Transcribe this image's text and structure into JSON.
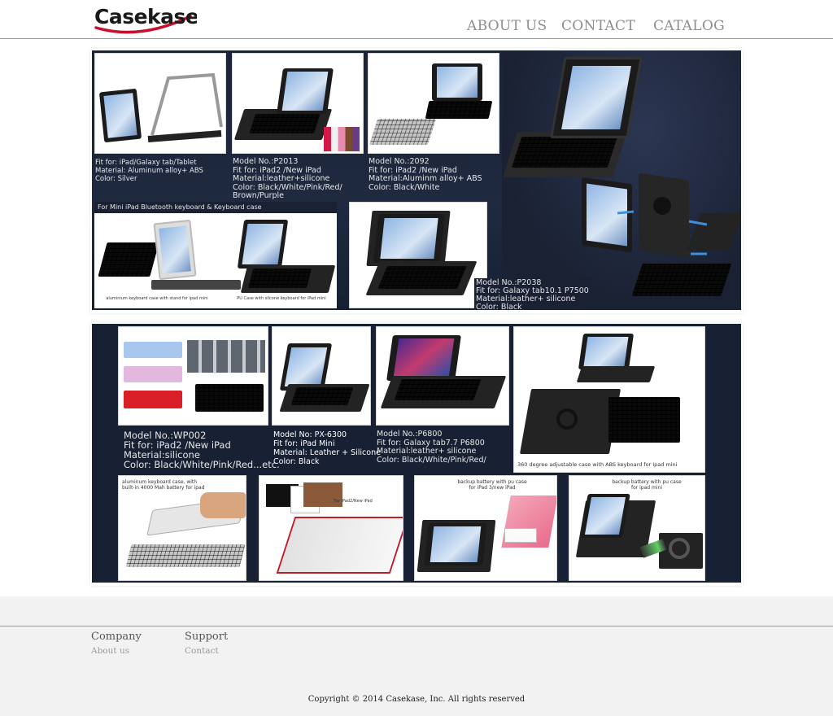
{
  "header": {
    "brand": "Casekase",
    "nav": [
      "ABOUT US",
      "CONTACT",
      "CATALOG"
    ]
  },
  "banner1": {
    "captions": [
      "Fit for: iPad/Galaxy tab/Tablet\nMaterial: Aluminum alloy+ ABS\nColor: Silver",
      "Model No.:P2013\nFit for: iPad2 /New iPad\nMaterial:leather+silicone\nColor: Black/White/Pink/Red/\n        Brown/Purple",
      "Model No.:2092\nFit for: iPad2 /New iPad\nMaterial:Aluminm alloy+ ABS\nColor: Black/White",
      "Model No.:P2038\nFit for: Galaxy tab10.1  P7500\nMaterial:leather+ silicone\nColor: Black"
    ],
    "mini_heading": "For Mini iPad Bluetooth keyboard & Keyboard case",
    "mini_labels": [
      "aluminium keyboard case with stand for ipad mini",
      "PU Case with silcone keyboard for iPad mini"
    ]
  },
  "banner2": {
    "captions": [
      "Model No.:WP002\nFit for: iPad2 /New iPad\nMaterial:silicone\nColor: Black/White/Pink/Red...etc.",
      "Model No: PX-6300\nFit for: iPad Mini\nMaterial: Leather + Silicone\nColor: Black",
      "Model No.:P6800\nFit for: Galaxy tab7.7  P6800\nMaterial:leather+ silicone\nColor: Black/White/Pink/Red/"
    ],
    "rotate_label": "360 degree adjustable case with ABS keyboard for ipad mini",
    "bottom_labels": [
      "aluminum keyboard case, with\nbuilt-in 4000 Mah battery for ipad",
      "For iPad2/New iPad",
      "backup battery with pu case\nfor iPad 3/new iPad",
      "backup battery with pu case\nfor ipad mini"
    ]
  },
  "footer": {
    "columns": [
      {
        "heading": "Company",
        "link": "About us"
      },
      {
        "heading": "Support",
        "link": "Contact"
      }
    ],
    "copyright": "Copyright © 2014 Casekase, Inc. All rights reserved"
  },
  "colors": {
    "logo_red": "#c8102e",
    "banner_bg": "#1a2133",
    "nav_gray": "#8e8e8e"
  }
}
